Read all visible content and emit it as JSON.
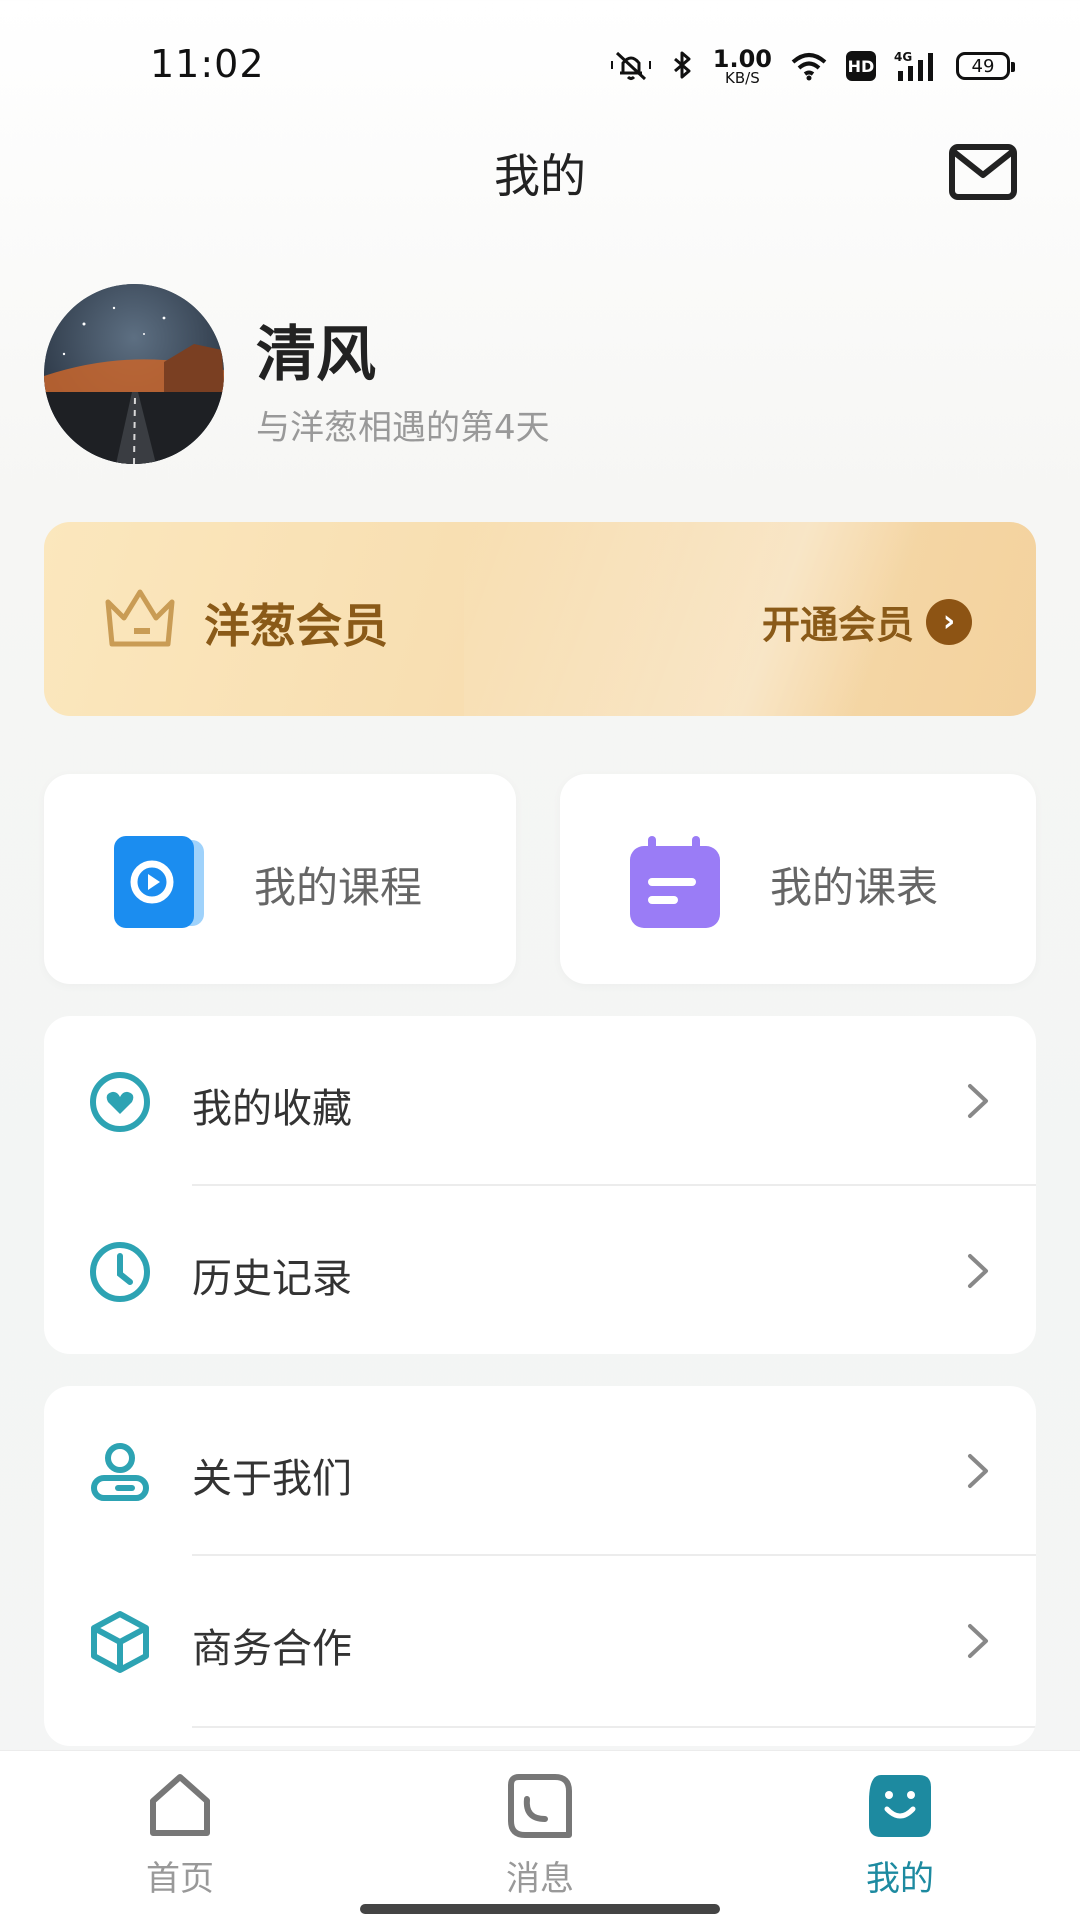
{
  "status_bar": {
    "time": "11:02",
    "net_speed_value": "1.00",
    "net_speed_unit": "KB/S",
    "hd": "HD",
    "network": "4G",
    "battery": "49",
    "icons": [
      "mute-icon",
      "bluetooth-icon",
      "wifi-icon",
      "signal-icon"
    ]
  },
  "header": {
    "title": "我的",
    "mail_icon": "mail-icon"
  },
  "profile": {
    "name": "清风",
    "subtitle": "与洋葱相遇的第4天"
  },
  "vip": {
    "title": "洋葱会员",
    "action": "开通会员",
    "accent": "#8a5a18"
  },
  "quick": {
    "courses": {
      "label": "我的课程",
      "icon": "play-icon",
      "color": "#1b8df0"
    },
    "schedule": {
      "label": "我的课表",
      "icon": "calendar-icon",
      "color": "#9a7cf6"
    }
  },
  "menu": {
    "group1": [
      {
        "label": "我的收藏",
        "icon": "heart-icon"
      },
      {
        "label": "历史记录",
        "icon": "clock-icon"
      }
    ],
    "group2": [
      {
        "label": "关于我们",
        "icon": "user-icon"
      },
      {
        "label": "商务合作",
        "icon": "cube-icon"
      }
    ]
  },
  "nav": {
    "home": "首页",
    "messages": "消息",
    "mine": "我的",
    "active": "mine",
    "active_color": "#1d8aa0"
  }
}
